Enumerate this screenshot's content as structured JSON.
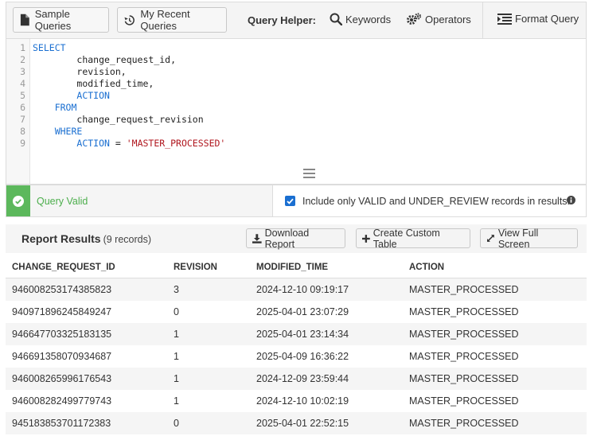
{
  "toolbar": {
    "sample_queries": "Sample Queries",
    "recent_queries": "My Recent Queries",
    "query_helper_label": "Query Helper:",
    "keywords": "Keywords",
    "operators": "Operators",
    "format_query": "Format Query"
  },
  "editor": {
    "lines": [
      {
        "num": "1",
        "indent": "",
        "parts": [
          {
            "t": "SELECT",
            "k": "kw"
          }
        ]
      },
      {
        "num": "2",
        "indent": "        ",
        "parts": [
          {
            "t": "change_request_id,",
            "k": ""
          }
        ]
      },
      {
        "num": "3",
        "indent": "        ",
        "parts": [
          {
            "t": "revision,",
            "k": ""
          }
        ]
      },
      {
        "num": "4",
        "indent": "        ",
        "parts": [
          {
            "t": "modified_time,",
            "k": ""
          }
        ]
      },
      {
        "num": "5",
        "indent": "        ",
        "parts": [
          {
            "t": "ACTION",
            "k": "kw"
          }
        ]
      },
      {
        "num": "6",
        "indent": "    ",
        "parts": [
          {
            "t": "FROM",
            "k": "kw"
          }
        ]
      },
      {
        "num": "7",
        "indent": "        ",
        "parts": [
          {
            "t": "change_request_revision",
            "k": ""
          }
        ]
      },
      {
        "num": "8",
        "indent": "    ",
        "parts": [
          {
            "t": "WHERE",
            "k": "kw"
          }
        ]
      },
      {
        "num": "9",
        "indent": "        ",
        "parts": [
          {
            "t": "ACTION",
            "k": "kw"
          },
          {
            "t": " = ",
            "k": ""
          },
          {
            "t": "'MASTER_PROCESSED'",
            "k": "str"
          }
        ]
      }
    ]
  },
  "status": {
    "valid_text": "Query Valid",
    "checkbox_label": "Include only VALID and UNDER_REVIEW records in results."
  },
  "results": {
    "title": "Report Results",
    "count": "(9 records)",
    "download": "Download Report",
    "create_table": "Create Custom Table",
    "full_screen": "View Full Screen",
    "columns": [
      "CHANGE_REQUEST_ID",
      "REVISION",
      "MODIFIED_TIME",
      "ACTION"
    ],
    "rows": [
      [
        "946008253174385823",
        "3",
        "2024-12-10 09:19:17",
        "MASTER_PROCESSED"
      ],
      [
        "940971896245849247",
        "0",
        "2025-04-01 23:07:29",
        "MASTER_PROCESSED"
      ],
      [
        "946647703325183135",
        "1",
        "2025-04-01 23:14:34",
        "MASTER_PROCESSED"
      ],
      [
        "946691358070934687",
        "1",
        "2025-04-09 16:36:22",
        "MASTER_PROCESSED"
      ],
      [
        "946008265996176543",
        "1",
        "2024-12-09 23:59:44",
        "MASTER_PROCESSED"
      ],
      [
        "946008282499779743",
        "1",
        "2024-12-10 10:02:19",
        "MASTER_PROCESSED"
      ],
      [
        "945183853701172383",
        "0",
        "2025-04-01 22:52:15",
        "MASTER_PROCESSED"
      ]
    ]
  },
  "colors": {
    "keyword": "#1a6fd1",
    "string": "#b0171f",
    "valid": "#5cb85c",
    "checkbox": "#1a6fd1"
  },
  "icons": {
    "sample_queries": "document-icon",
    "recent_queries": "history-icon",
    "keywords": "search-icon",
    "operators": "gears-icon",
    "format_query": "format-lines-icon",
    "download": "download-icon",
    "create_table": "plus-icon",
    "full_screen": "expand-icon"
  }
}
